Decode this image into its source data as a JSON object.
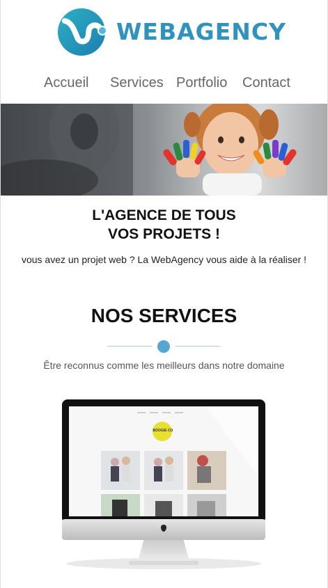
{
  "brand": {
    "name": "WEBAGENCY",
    "accent": "#2f93bd",
    "dot_color": "#55a7d2"
  },
  "nav": {
    "items": [
      "Accueil",
      "Services",
      "Portfolio",
      "Contact"
    ]
  },
  "hero": {
    "image": "girl-painted-hands-photo"
  },
  "tagline": {
    "line1": "L'AGENCE DE TOUS",
    "line2": "VOS PROJETS !"
  },
  "intro": {
    "text": "vous avez un projet web ? La WebAgency vous aide à la réaliser !"
  },
  "services": {
    "title": "NOS SERVICES",
    "subtitle": "Être reconnus comme les meilleurs dans notre domaine",
    "screen_logo": "BOOGIE CO"
  }
}
